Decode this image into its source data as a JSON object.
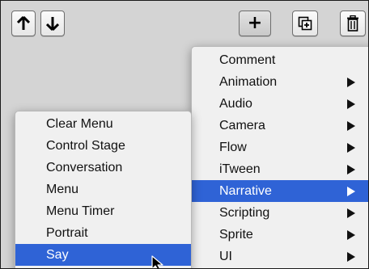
{
  "toolbar": {
    "up_icon": "arrow-up-icon",
    "down_icon": "arrow-down-icon",
    "add_label": "+",
    "duplicate_icon": "duplicate-icon",
    "delete_icon": "trash-icon"
  },
  "colors": {
    "highlight": "#2f63d6",
    "menu_background": "#f0f0f0",
    "panel_background": "#d4d4d4"
  },
  "main_menu": {
    "items": [
      {
        "label": "Comment",
        "submenu": false,
        "active": false
      },
      {
        "label": "Animation",
        "submenu": true,
        "active": false
      },
      {
        "label": "Audio",
        "submenu": true,
        "active": false
      },
      {
        "label": "Camera",
        "submenu": true,
        "active": false
      },
      {
        "label": "Flow",
        "submenu": true,
        "active": false
      },
      {
        "label": "iTween",
        "submenu": true,
        "active": false
      },
      {
        "label": "Narrative",
        "submenu": true,
        "active": true
      },
      {
        "label": "Scripting",
        "submenu": true,
        "active": false
      },
      {
        "label": "Sprite",
        "submenu": true,
        "active": false
      },
      {
        "label": "UI",
        "submenu": true,
        "active": false
      }
    ]
  },
  "submenu": {
    "items": [
      {
        "label": "Clear Menu",
        "active": false
      },
      {
        "label": "Control Stage",
        "active": false
      },
      {
        "label": "Conversation",
        "active": false
      },
      {
        "label": "Menu",
        "active": false
      },
      {
        "label": "Menu Timer",
        "active": false
      },
      {
        "label": "Portrait",
        "active": false
      },
      {
        "label": "Say",
        "active": true
      }
    ]
  }
}
